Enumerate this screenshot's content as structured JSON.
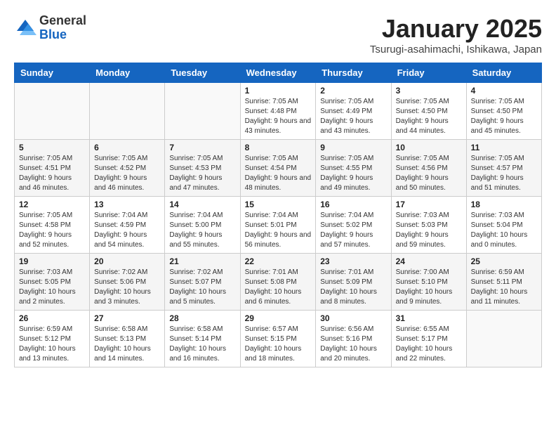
{
  "logo": {
    "general": "General",
    "blue": "Blue"
  },
  "header": {
    "title": "January 2025",
    "subtitle": "Tsurugi-asahimachi, Ishikawa, Japan"
  },
  "weekdays": [
    "Sunday",
    "Monday",
    "Tuesday",
    "Wednesday",
    "Thursday",
    "Friday",
    "Saturday"
  ],
  "weeks": [
    [
      {
        "day": "",
        "info": ""
      },
      {
        "day": "",
        "info": ""
      },
      {
        "day": "",
        "info": ""
      },
      {
        "day": "1",
        "info": "Sunrise: 7:05 AM\nSunset: 4:48 PM\nDaylight: 9 hours and 43 minutes."
      },
      {
        "day": "2",
        "info": "Sunrise: 7:05 AM\nSunset: 4:49 PM\nDaylight: 9 hours and 43 minutes."
      },
      {
        "day": "3",
        "info": "Sunrise: 7:05 AM\nSunset: 4:50 PM\nDaylight: 9 hours and 44 minutes."
      },
      {
        "day": "4",
        "info": "Sunrise: 7:05 AM\nSunset: 4:50 PM\nDaylight: 9 hours and 45 minutes."
      }
    ],
    [
      {
        "day": "5",
        "info": "Sunrise: 7:05 AM\nSunset: 4:51 PM\nDaylight: 9 hours and 46 minutes."
      },
      {
        "day": "6",
        "info": "Sunrise: 7:05 AM\nSunset: 4:52 PM\nDaylight: 9 hours and 46 minutes."
      },
      {
        "day": "7",
        "info": "Sunrise: 7:05 AM\nSunset: 4:53 PM\nDaylight: 9 hours and 47 minutes."
      },
      {
        "day": "8",
        "info": "Sunrise: 7:05 AM\nSunset: 4:54 PM\nDaylight: 9 hours and 48 minutes."
      },
      {
        "day": "9",
        "info": "Sunrise: 7:05 AM\nSunset: 4:55 PM\nDaylight: 9 hours and 49 minutes."
      },
      {
        "day": "10",
        "info": "Sunrise: 7:05 AM\nSunset: 4:56 PM\nDaylight: 9 hours and 50 minutes."
      },
      {
        "day": "11",
        "info": "Sunrise: 7:05 AM\nSunset: 4:57 PM\nDaylight: 9 hours and 51 minutes."
      }
    ],
    [
      {
        "day": "12",
        "info": "Sunrise: 7:05 AM\nSunset: 4:58 PM\nDaylight: 9 hours and 52 minutes."
      },
      {
        "day": "13",
        "info": "Sunrise: 7:04 AM\nSunset: 4:59 PM\nDaylight: 9 hours and 54 minutes."
      },
      {
        "day": "14",
        "info": "Sunrise: 7:04 AM\nSunset: 5:00 PM\nDaylight: 9 hours and 55 minutes."
      },
      {
        "day": "15",
        "info": "Sunrise: 7:04 AM\nSunset: 5:01 PM\nDaylight: 9 hours and 56 minutes."
      },
      {
        "day": "16",
        "info": "Sunrise: 7:04 AM\nSunset: 5:02 PM\nDaylight: 9 hours and 57 minutes."
      },
      {
        "day": "17",
        "info": "Sunrise: 7:03 AM\nSunset: 5:03 PM\nDaylight: 9 hours and 59 minutes."
      },
      {
        "day": "18",
        "info": "Sunrise: 7:03 AM\nSunset: 5:04 PM\nDaylight: 10 hours and 0 minutes."
      }
    ],
    [
      {
        "day": "19",
        "info": "Sunrise: 7:03 AM\nSunset: 5:05 PM\nDaylight: 10 hours and 2 minutes."
      },
      {
        "day": "20",
        "info": "Sunrise: 7:02 AM\nSunset: 5:06 PM\nDaylight: 10 hours and 3 minutes."
      },
      {
        "day": "21",
        "info": "Sunrise: 7:02 AM\nSunset: 5:07 PM\nDaylight: 10 hours and 5 minutes."
      },
      {
        "day": "22",
        "info": "Sunrise: 7:01 AM\nSunset: 5:08 PM\nDaylight: 10 hours and 6 minutes."
      },
      {
        "day": "23",
        "info": "Sunrise: 7:01 AM\nSunset: 5:09 PM\nDaylight: 10 hours and 8 minutes."
      },
      {
        "day": "24",
        "info": "Sunrise: 7:00 AM\nSunset: 5:10 PM\nDaylight: 10 hours and 9 minutes."
      },
      {
        "day": "25",
        "info": "Sunrise: 6:59 AM\nSunset: 5:11 PM\nDaylight: 10 hours and 11 minutes."
      }
    ],
    [
      {
        "day": "26",
        "info": "Sunrise: 6:59 AM\nSunset: 5:12 PM\nDaylight: 10 hours and 13 minutes."
      },
      {
        "day": "27",
        "info": "Sunrise: 6:58 AM\nSunset: 5:13 PM\nDaylight: 10 hours and 14 minutes."
      },
      {
        "day": "28",
        "info": "Sunrise: 6:58 AM\nSunset: 5:14 PM\nDaylight: 10 hours and 16 minutes."
      },
      {
        "day": "29",
        "info": "Sunrise: 6:57 AM\nSunset: 5:15 PM\nDaylight: 10 hours and 18 minutes."
      },
      {
        "day": "30",
        "info": "Sunrise: 6:56 AM\nSunset: 5:16 PM\nDaylight: 10 hours and 20 minutes."
      },
      {
        "day": "31",
        "info": "Sunrise: 6:55 AM\nSunset: 5:17 PM\nDaylight: 10 hours and 22 minutes."
      },
      {
        "day": "",
        "info": ""
      }
    ]
  ]
}
